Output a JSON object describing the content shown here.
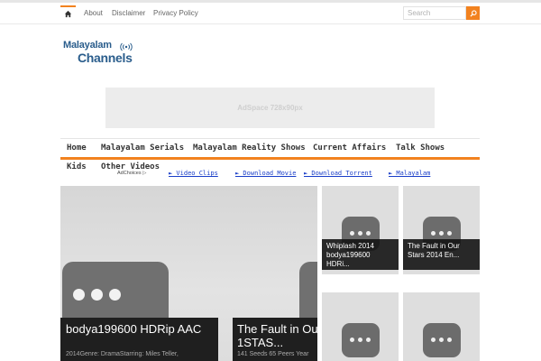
{
  "topbar": {
    "links": [
      "About",
      "Disclaimer",
      "Privacy Policy"
    ],
    "search_placeholder": "Search"
  },
  "logo": {
    "line1": "Malayalam",
    "line2": "Channels"
  },
  "ad": {
    "label": "AdSpace 728x90px"
  },
  "nav": {
    "items": [
      "Home",
      "Malayalam Serials",
      "Malayalam Reality Shows",
      "Current Affairs",
      "Talk Shows",
      "Kids",
      "Other Videos"
    ]
  },
  "adlinks": {
    "adchoices": "AdChoices ▷",
    "links": [
      "► Video Clips",
      "► Download Movie",
      "► Download Torrent",
      "► Malayalam"
    ]
  },
  "slider": {
    "slides": [
      {
        "title": "bodya199600 HDRip AAC",
        "meta": "2014Genre: DramaStarring: Miles Teller,"
      },
      {
        "title": "The Fault in Ou",
        "title2": "1STAS...",
        "meta": "141 Seeds 65 Peers Year"
      }
    ]
  },
  "tiles": [
    {
      "title": "Whiplash 2014 bodya199600 HDRi..."
    },
    {
      "title": "The Fault in Our Stars 2014 En..."
    }
  ],
  "colors": {
    "accent": "#f2821f",
    "link": "#1a3ec8",
    "logo": "#2a5d8c"
  }
}
